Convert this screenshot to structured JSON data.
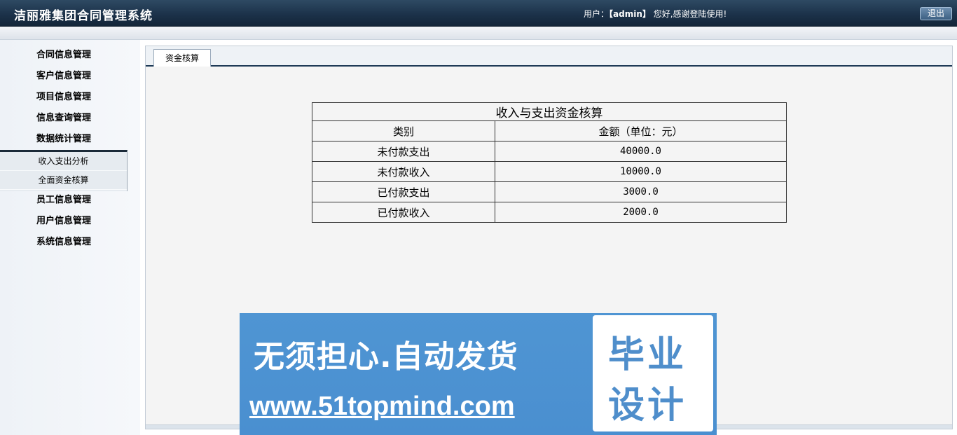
{
  "header": {
    "title": "洁丽雅集团合同管理系统",
    "user_prefix": "用户：",
    "user_name": "【admin】",
    "user_suffix": " 您好,感谢登陆使用!",
    "logout_label": "退出"
  },
  "sidebar": {
    "items": [
      {
        "label": "合同信息管理"
      },
      {
        "label": "客户信息管理"
      },
      {
        "label": "项目信息管理"
      },
      {
        "label": "信息查询管理"
      },
      {
        "label": "数据统计管理"
      },
      {
        "label": "员工信息管理"
      },
      {
        "label": "用户信息管理"
      },
      {
        "label": "系统信息管理"
      }
    ],
    "submenu": [
      {
        "label": "收入支出分析"
      },
      {
        "label": "全面资金核算"
      }
    ]
  },
  "main": {
    "tab_label": "资金核算",
    "table": {
      "caption": "收入与支出资金核算",
      "headers": [
        "类别",
        "金额（单位：元）"
      ],
      "rows": [
        {
          "category": "未付款支出",
          "amount": "40000.0"
        },
        {
          "category": "未付款收入",
          "amount": "10000.0"
        },
        {
          "category": "已付款支出",
          "amount": "3000.0"
        },
        {
          "category": "已付款收入",
          "amount": "2000.0"
        }
      ]
    }
  },
  "ad": {
    "line1": "无须担心.自动发货",
    "line2": "www.51topmind.com",
    "box_line1": "毕业",
    "box_line2": "设计"
  }
}
